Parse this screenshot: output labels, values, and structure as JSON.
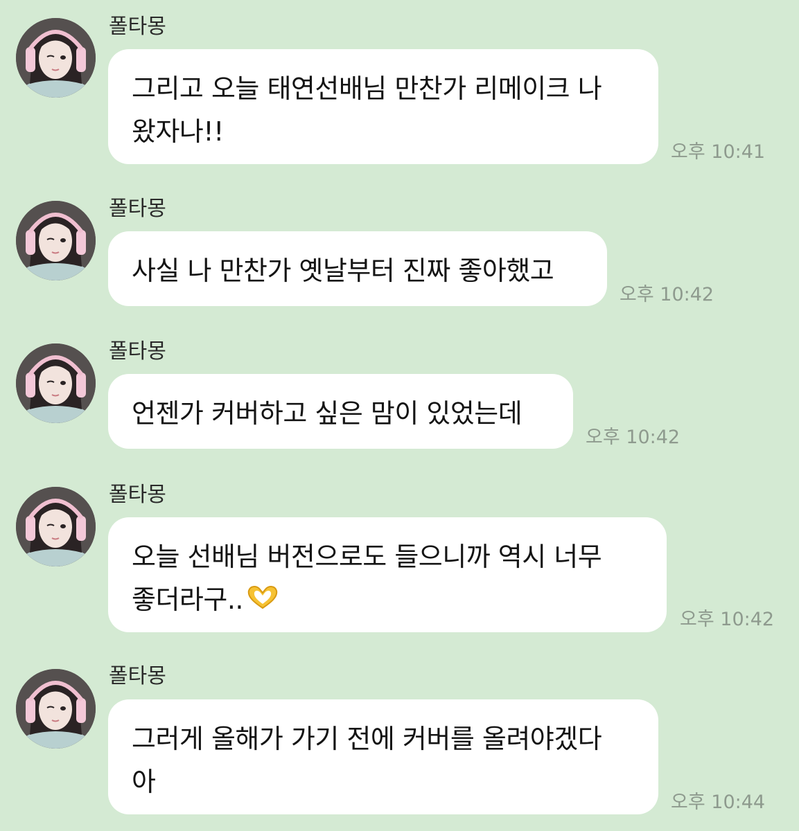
{
  "chat": {
    "messages": [
      {
        "sender": "폴타몽",
        "lines": [
          "그리고 오늘 태연선배님 만찬가 리메이크 나",
          "왔자나!!"
        ],
        "time": "오후 10:41"
      },
      {
        "sender": "폴타몽",
        "lines": [
          "사실 나 만찬가 옛날부터 진짜 좋아했고"
        ],
        "time": "오후 10:42"
      },
      {
        "sender": "폴타몽",
        "lines": [
          "언젠가 커버하고 싶은 맘이 있었는데"
        ],
        "time": "오후 10:42"
      },
      {
        "sender": "폴타몽",
        "lines": [
          "오늘 선배님 버전으로도 들으니까 역시 너무",
          "좋더라구.."
        ],
        "emoji": "heart-hands-emoji",
        "time": "오후 10:42"
      },
      {
        "sender": "폴타몽",
        "lines": [
          "그러게 올해가 가기 전에 커버를 올려야겠다",
          "아"
        ],
        "time": "오후 10:44"
      }
    ]
  },
  "colors": {
    "background": "#d4ead3",
    "bubble": "#ffffff",
    "timestamp": "#8e9a8e"
  }
}
